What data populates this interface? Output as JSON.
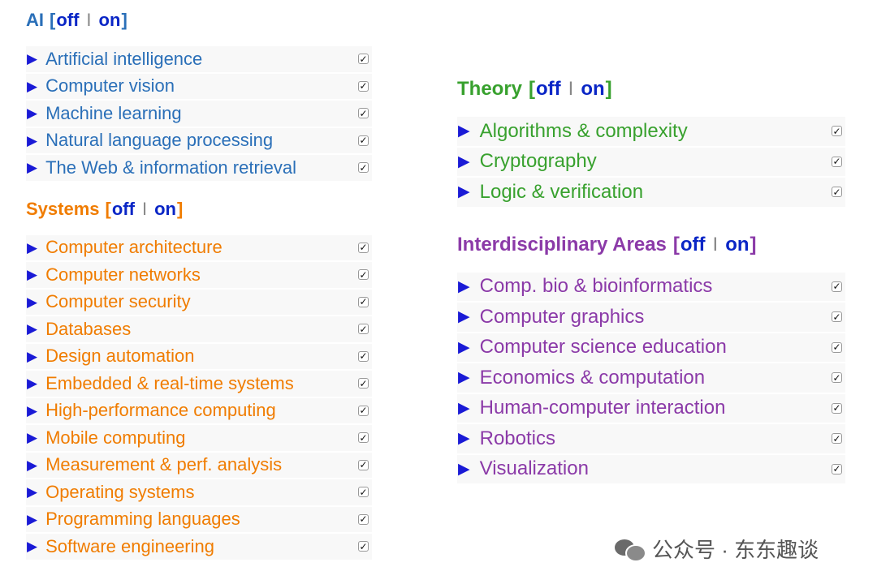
{
  "toggle": {
    "bracket_open": "[",
    "off": "off",
    "sep": "I",
    "on": "on",
    "bracket_close": "]"
  },
  "checkbox_mark": "✓",
  "arrow": "▶",
  "colors": {
    "ai": "#2a6fb8",
    "systems": "#f07c00",
    "theory": "#38a12e",
    "interdisciplinary": "#8b3aa8",
    "toggle_link": "#0a26c6",
    "arrow": "#1a1ad6"
  },
  "categories": {
    "ai": {
      "title": "AI",
      "items": [
        "Artificial intelligence",
        "Computer vision",
        "Machine learning",
        "Natural language processing",
        "The Web & information retrieval"
      ]
    },
    "systems": {
      "title": "Systems",
      "items": [
        "Computer architecture",
        "Computer networks",
        "Computer security",
        "Databases",
        "Design automation",
        "Embedded & real-time systems",
        "High-performance computing",
        "Mobile computing",
        "Measurement & perf. analysis",
        "Operating systems",
        "Programming languages",
        "Software engineering"
      ]
    },
    "theory": {
      "title": "Theory",
      "items": [
        "Algorithms & complexity",
        "Cryptography",
        "Logic & verification"
      ]
    },
    "interdisciplinary": {
      "title": "Interdisciplinary Areas",
      "items": [
        "Comp. bio & bioinformatics",
        "Computer graphics",
        "Computer science education",
        "Economics & computation",
        "Human-computer interaction",
        "Robotics",
        "Visualization"
      ]
    }
  },
  "watermark": {
    "text": "公众号 · 东东趣谈",
    "icon": "wechat-icon"
  }
}
